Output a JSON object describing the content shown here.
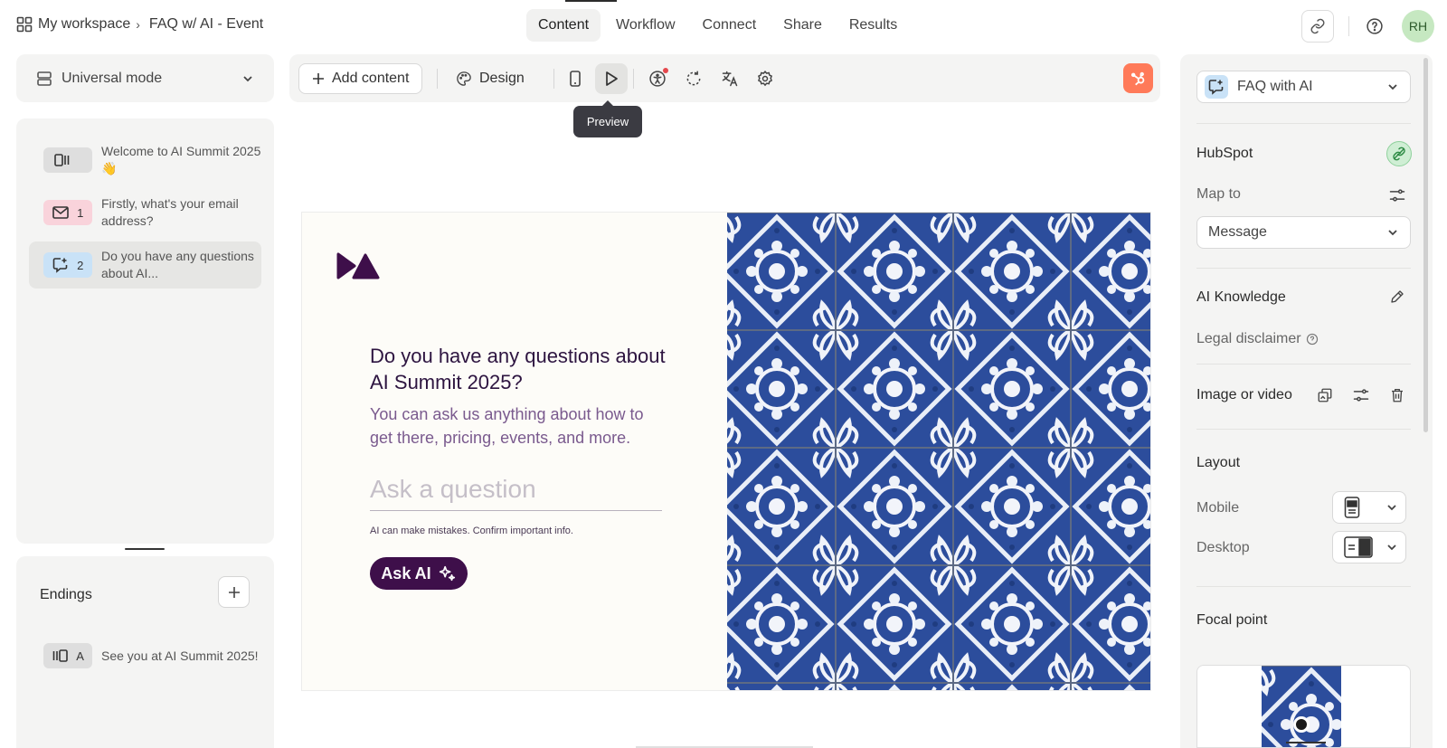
{
  "breadcrumb": {
    "workspace": "My workspace",
    "form": "FAQ w/ AI - Event"
  },
  "nav": {
    "tabs": [
      "Content",
      "Workflow",
      "Connect",
      "Share",
      "Results"
    ],
    "active": "Content"
  },
  "user": {
    "initials": "RH"
  },
  "left": {
    "mode_label": "Universal mode",
    "questions": [
      {
        "badge": "",
        "text": "Welcome to AI Summit 2025 👋"
      },
      {
        "badge": "1",
        "text": "Firstly, what's your email address?"
      },
      {
        "badge": "2",
        "text": "Do you have any questions about AI..."
      }
    ],
    "endings_title": "Endings",
    "endings": [
      {
        "badge": "A",
        "text": "See you at AI Summit 2025!"
      }
    ]
  },
  "toolbar": {
    "add_content": "Add content",
    "design": "Design",
    "tooltip": "Preview"
  },
  "canvas": {
    "title": "Do you have any questions about AI Summit 2025?",
    "subtitle": "You can ask us anything about how to get there, pricing, events, and more.",
    "input_placeholder": "Ask a question",
    "disclaimer": "AI can make mistakes. Confirm important info.",
    "button": "Ask AI"
  },
  "right": {
    "block_type": "FAQ with AI",
    "hubspot": "HubSpot",
    "map_to": "Map to",
    "map_value": "Message",
    "ai_knowledge": "AI Knowledge",
    "legal": "Legal disclaimer",
    "image_video": "Image or video",
    "layout": "Layout",
    "mobile": "Mobile",
    "desktop": "Desktop",
    "focal": "Focal point"
  },
  "colors": {
    "brand": "#3e0f4a",
    "hubspot": "#ff7a59",
    "tile_blue": "#2b4ea0"
  }
}
